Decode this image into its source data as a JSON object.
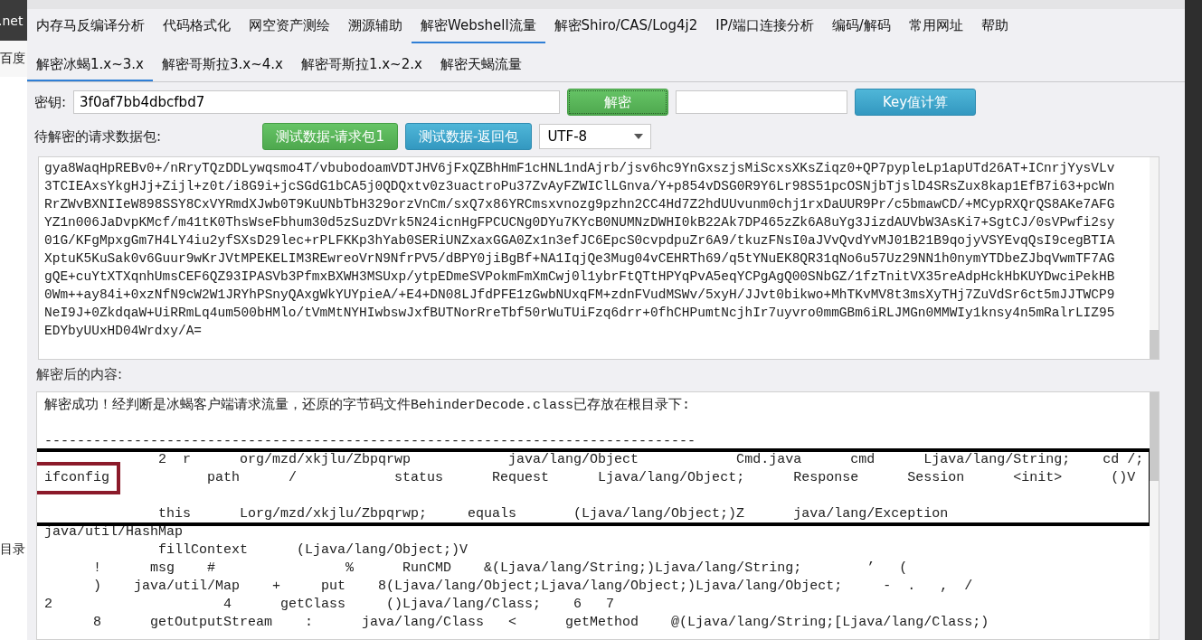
{
  "background_browser": {
    "texts": [
      ".net",
      "百度",
      "目录"
    ]
  },
  "menu": [
    {
      "label": "内存马反编译分析",
      "selected": false
    },
    {
      "label": "代码格式化",
      "selected": false
    },
    {
      "label": "网空资产测绘",
      "selected": false
    },
    {
      "label": "溯源辅助",
      "selected": false
    },
    {
      "label": "解密Webshell流量",
      "selected": true
    },
    {
      "label": "解密Shiro/CAS/Log4j2",
      "selected": false
    },
    {
      "label": "IP/端口连接分析",
      "selected": false
    },
    {
      "label": "编码/解码",
      "selected": false
    },
    {
      "label": "常用网址",
      "selected": false
    },
    {
      "label": "帮助",
      "selected": false
    }
  ],
  "sub_tabs": [
    {
      "label": "解密冰蝎1.x~3.x",
      "selected": true
    },
    {
      "label": "解密哥斯拉3.x~4.x",
      "selected": false
    },
    {
      "label": "解密哥斯拉1.x~2.x",
      "selected": false
    },
    {
      "label": "解密天蝎流量",
      "selected": false
    }
  ],
  "key_row": {
    "label": "密钥:",
    "key": "3f0af7bb4dbcfbd7",
    "decrypt_button": {
      "label": "解密",
      "kind": "success"
    },
    "calc_button": {
      "label": "Key值计算",
      "kind": "info"
    }
  },
  "request_row": {
    "label": "待解密的请求数据包:",
    "buttons": [
      {
        "label": "测试数据-请求包1",
        "kind": "success"
      },
      {
        "label": "测试数据-返回包",
        "kind": "info"
      }
    ],
    "encoding": "UTF-8"
  },
  "request_data": {
    "lines": [
      "gya8WaqHpREBv0+/nRryTQzDDLywqsmo4T/vbubodoamVDTJHV6jFxQZBhHmF1cHNL1ndAjrb/jsv6hc9YnGxszjsMiScxsXKsZiqz0+QP7pypleLp1apUTd26AT+ICnrjYysVLv",
      "3TCIEAxsYkgHJj+Zijl+z0t/i8G9i+jcSGdG1bCA5j0QDQxtv0z3uactroPu37ZvAyFZWIClLGnva/Y+p854vDSG0R9Y6Lr98S51pcOSNjbTjslD4SRsZux8kap1EfB7i63+pcWn",
      "RrZWvBXNIIeW898SSY8CxVYRmdXJwb0T9KuUNbTbH329orzVnCm/sxQ7x86YRCmsxvnozg9pzhn2CC4Hd7Z2hdUUvunm0chj1rxDaUUR9Pr/c5bmawCD/+MCypRXQrQS8AKe7AFG",
      "YZ1n006JaDvpKMcf/m41tK0ThsWseFbhum30d5zSuzDVrk5N24icnHgFPCUCNg0DYu7KYcB0NUMNzDWHI0kB22Ak7DP465zZk6A8uYg3JizdAUVbW3AsKi7+SgtCJ/0sVPwfi2sy",
      "01G/KFgMpxgGm7H4LY4iu2yfSXsD29lec+rPLFKKp3hYab0SERiUNZxaxGGA0Zx1n3efJC6EpcS0cvpdpuZr6A9/tkuzFNsI0aJVvQvdYvMJ01B21B9qojyVSYEvqQsI9cegBTIA",
      "XptuK5KuSak0v6Guur9wKrJVtMPEKELIM3REwreoVrN9NfrPV5/dBPY0jiBgBf+NA1IqjQe3Mug04vCEHRTh69/q5tYNuEK8QR31qNo6u57Uz29NN1h0nymYTDbeZJbqVwmTF7AG",
      "gQE+cuYtXTXqnhUmsCEF6QZ93IPASVb3PfmxBXWH3MSUxp/ytpEDmeSVPokmFmXmCwj0l1ybrFtQTtHPYqPvA5eqYCPgAgQ00SNbGZ/1fzTnitVX35reAdpHckHbKUYDwciPekHB",
      "0Wm++ay84i+0xzNfN9cW2W1JRYhPSnyQAxgWkYUYpieA/+E4+DN08LJfdPFE1zGwbNUxqFM+zdnFVudMSWv/5xyH/JJvt0bikwo+MhTKvMV8t3msXyTHj7ZuVdSr6ct5mJJTWCP9",
      "NeI9J+0ZkdqaW+UiRRmLq4um500bHMlo/tVmMtNYHIwbswJxfBUTNorRreTbf50rWuTUiFzq6drr+0fhCHPumtNcjhIr7uyvro0mmGBm6iRLJMGn0MMWIy1knsy4n5mRalrLIZ95",
      "EDYbyUUxHD04Wrdxy/A="
    ]
  },
  "result": {
    "label": "解密后的内容:",
    "lines": [
      {
        "kind": "text",
        "text": "解密成功！经判断是冰蝎客户端请求流量，还原的字节码文件BehinderDecode.class已存放在根目录下:",
        "framed": false
      },
      {
        "kind": "blank",
        "framed": false
      },
      {
        "kind": "text",
        "text": "--------------------------------------------------------------------------------",
        "framed": false
      },
      {
        "kind": "text",
        "text": "              2  r      org/mzd/xkjlu/Zbpqrwp            java/lang/Object            Cmd.java      cmd      Ljava/lang/String;    cd /;",
        "framed": true
      },
      {
        "kind": "marked",
        "mark": "ifconfig",
        "text": "            path      /            status      Request      Ljava/lang/Object;      Response      Session      <init>      ()V",
        "framed": true
      },
      {
        "kind": "blank",
        "framed": true
      },
      {
        "kind": "text",
        "text": "              this      Lorg/mzd/xkjlu/Zbpqrwp;     equals       (Ljava/lang/Object;)Z      java/lang/Exception",
        "framed": true
      },
      {
        "kind": "text",
        "text": "java/util/HashMap",
        "framed": false
      },
      {
        "kind": "text",
        "text": "              fillContext      (Ljava/lang/Object;)V",
        "framed": false
      },
      {
        "kind": "text",
        "text": "      !      msg    #                %      RunCMD    &(Ljava/lang/String;)Ljava/lang/String;        ’   (",
        "framed": false
      },
      {
        "kind": "text",
        "text": "      )    java/util/Map    +     put    8(Ljava/lang/Object;Ljava/lang/Object;)Ljava/lang/Object;     -  .   ,  /",
        "framed": false
      },
      {
        "kind": "text",
        "text": "2                     4      getClass     ()Ljava/lang/Class;    6   7",
        "framed": false
      },
      {
        "kind": "text",
        "text": "      8      getOutputStream    :      java/lang/Class   <      getMethod    @(Ljava/lang/String;[Ljava/lang/Class;)",
        "framed": false
      }
    ]
  }
}
